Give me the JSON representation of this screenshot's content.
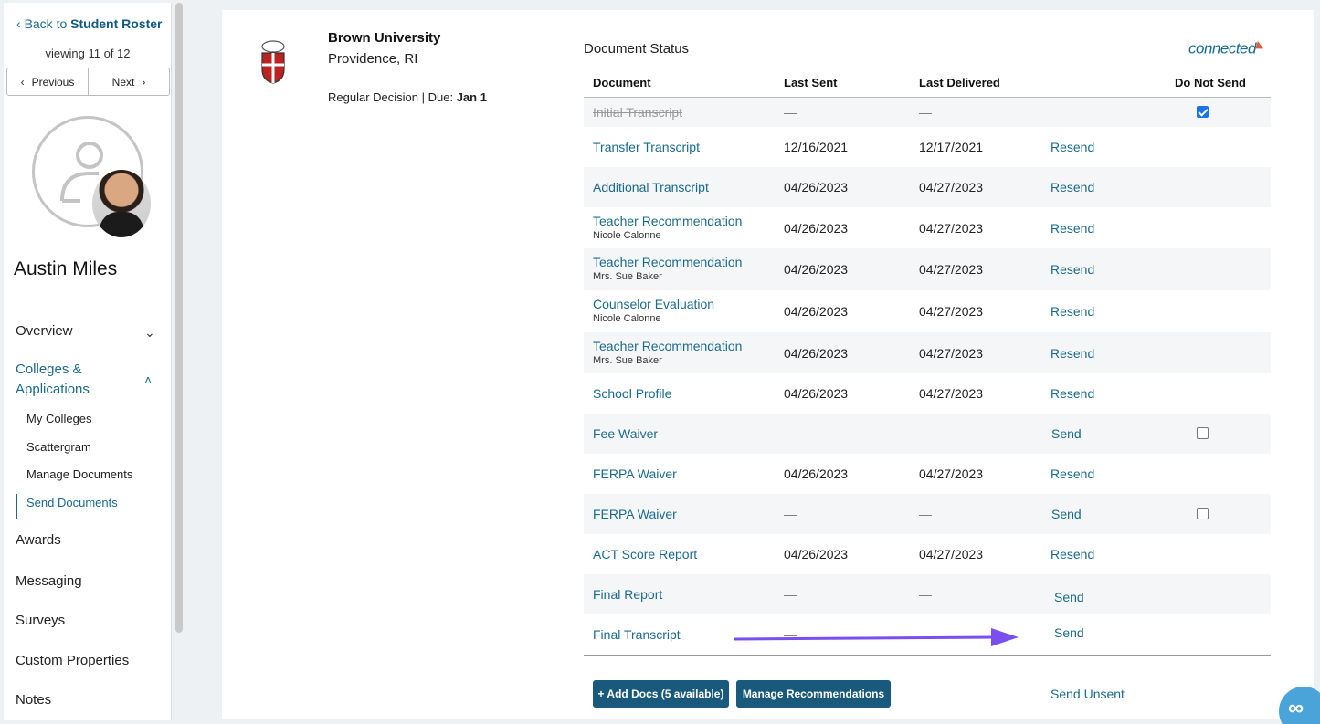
{
  "sidebar": {
    "back_prefix": "Back to",
    "back_target": "Student Roster",
    "viewing": "viewing 11 of 12",
    "prev_label": "Previous",
    "next_label": "Next",
    "student_name": "Austin Miles",
    "nav": [
      {
        "label": "Overview"
      },
      {
        "label": "Colleges &"
      },
      {
        "label": "Applications"
      },
      {
        "label": "Awards"
      },
      {
        "label": "Messaging"
      },
      {
        "label": "Surveys"
      },
      {
        "label": "Custom Properties"
      },
      {
        "label": "Notes"
      }
    ],
    "subnav": [
      {
        "label": "My Colleges"
      },
      {
        "label": "Scattergram"
      },
      {
        "label": "Manage Documents"
      },
      {
        "label": "Send Documents"
      }
    ]
  },
  "college": {
    "name": "Brown University",
    "location": "Providence, RI",
    "decision_label": "Regular Decision | Due:",
    "due": "Jan 1"
  },
  "document_status": {
    "title": "Document Status",
    "brand": "connected",
    "columns": {
      "document": "Document",
      "last_sent": "Last Sent",
      "last_delivered": "Last Delivered",
      "do_not_send": "Do Not Send"
    },
    "rows": [
      {
        "doc": "Initial Transcript",
        "sub": "",
        "sent": "—",
        "delivered": "—",
        "action": "",
        "checkbox": "checked"
      },
      {
        "doc": "Transfer Transcript",
        "sub": "",
        "sent": "12/16/2021",
        "delivered": "12/17/2021",
        "action": "Resend",
        "checkbox": ""
      },
      {
        "doc": "Additional Transcript",
        "sub": "",
        "sent": "04/26/2023",
        "delivered": "04/27/2023",
        "action": "Resend",
        "checkbox": ""
      },
      {
        "doc": "Teacher Recommendation",
        "sub": "Nicole Calonne",
        "sent": "04/26/2023",
        "delivered": "04/27/2023",
        "action": "Resend",
        "checkbox": ""
      },
      {
        "doc": "Teacher Recommendation",
        "sub": "Mrs. Sue Baker",
        "sent": "04/26/2023",
        "delivered": "04/27/2023",
        "action": "Resend",
        "checkbox": ""
      },
      {
        "doc": "Counselor Evaluation",
        "sub": "Nicole Calonne",
        "sent": "04/26/2023",
        "delivered": "04/27/2023",
        "action": "Resend",
        "checkbox": ""
      },
      {
        "doc": "Teacher Recommendation",
        "sub": "Mrs. Sue Baker",
        "sent": "04/26/2023",
        "delivered": "04/27/2023",
        "action": "Resend",
        "checkbox": ""
      },
      {
        "doc": "School Profile",
        "sub": "",
        "sent": "04/26/2023",
        "delivered": "04/27/2023",
        "action": "Resend",
        "checkbox": ""
      },
      {
        "doc": "Fee Waiver",
        "sub": "",
        "sent": "—",
        "delivered": "—",
        "action": "Send",
        "checkbox": "unchecked"
      },
      {
        "doc": "FERPA Waiver",
        "sub": "",
        "sent": "04/26/2023",
        "delivered": "04/27/2023",
        "action": "Resend",
        "checkbox": ""
      },
      {
        "doc": "FERPA Waiver",
        "sub": "",
        "sent": "—",
        "delivered": "—",
        "action": "Send",
        "checkbox": "unchecked"
      },
      {
        "doc": "ACT Score Report",
        "sub": "",
        "sent": "04/26/2023",
        "delivered": "04/27/2023",
        "action": "Resend",
        "checkbox": ""
      },
      {
        "doc": "Final Report",
        "sub": "",
        "sent": "—",
        "delivered": "—",
        "action": "Send",
        "checkbox": ""
      },
      {
        "doc": "Final Transcript",
        "sub": "",
        "sent": "—",
        "delivered": "",
        "action": "Send",
        "checkbox": ""
      }
    ]
  },
  "buttons": {
    "add_docs": "+ Add Docs (5 available)",
    "manage_recs": "Manage Recommendations",
    "send_unsent": "Send Unsent"
  },
  "colors": {
    "link": "#1a6a8f",
    "button": "#195a7c",
    "annotation_arrow": "#7b4ef0"
  },
  "icons": [
    "chevron-left-icon",
    "chevron-right-icon",
    "chevron-down-icon",
    "chevron-up-icon",
    "avatar-placeholder-icon",
    "university-seal-icon",
    "checkbox-icon",
    "arrow-annotation-icon",
    "chat-help-icon"
  ]
}
